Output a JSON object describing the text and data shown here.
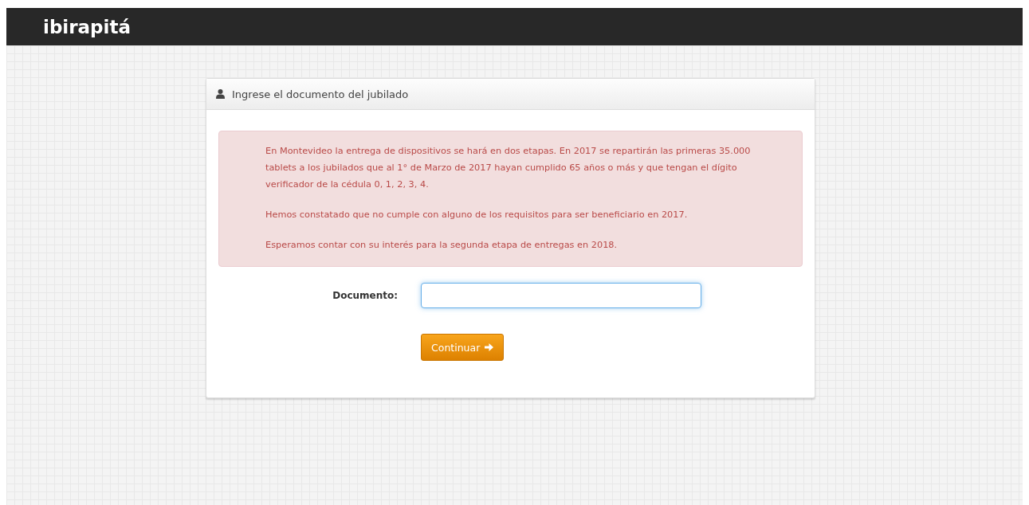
{
  "navbar": {
    "brand": "ibirapitá"
  },
  "panel": {
    "title": "Ingrese el documento del jubilado",
    "alert": {
      "paragraphs": [
        "En Montevideo la entrega de dispositivos se hará en dos etapas. En 2017 se repartirán las primeras 35.000 tablets a los jubilados que al 1° de Marzo de 2017 hayan cumplido 65 años o más y que tengan el dígito verificador de la cédula 0, 1, 2, 3, 4.",
        "Hemos constatado que no cumple con alguno de los requisitos para ser beneficiario en 2017.",
        "Esperamos contar con su interés para la segunda etapa de entregas en 2018."
      ]
    },
    "field": {
      "label": "Documento:",
      "focused": true
    },
    "button": {
      "label": "Continuar"
    }
  }
}
